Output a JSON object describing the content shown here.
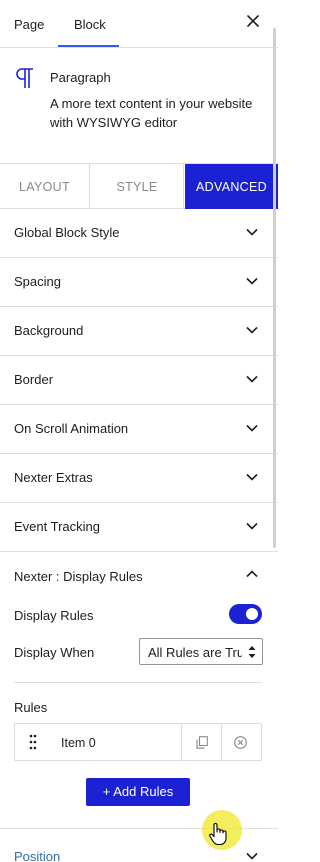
{
  "sidebar_tabs": {
    "page": "Page",
    "block": "Block"
  },
  "block_card": {
    "name": "Paragraph",
    "description": "A more text content in your website with WYSIWYG editor"
  },
  "settings_tabs": {
    "layout": "LAYOUT",
    "style": "STYLE",
    "advanced": "ADVANCED",
    "active": "ADVANCED"
  },
  "panels": [
    {
      "label": "Global Block Style"
    },
    {
      "label": "Spacing"
    },
    {
      "label": "Background"
    },
    {
      "label": "Border"
    },
    {
      "label": "On Scroll Animation"
    },
    {
      "label": "Nexter Extras"
    },
    {
      "label": "Event Tracking"
    }
  ],
  "display_rules": {
    "title": "Nexter : Display Rules",
    "toggle_label": "Display Rules",
    "toggle_on": true,
    "display_when_label": "Display When",
    "display_when_value": "All Rules are True",
    "rules_label": "Rules",
    "items": [
      {
        "label": "Item 0"
      }
    ],
    "add_button": "+ Add Rules"
  },
  "position_panel": {
    "label": "Position"
  },
  "colors": {
    "accent": "#1a22d3",
    "tab_underline": "#3858e9",
    "position_link": "#2f6fa8",
    "cursor_highlight": "#f0e828"
  },
  "icons": [
    "close-icon",
    "paragraph-icon",
    "chevron-down-icon",
    "chevron-up-icon",
    "drag-handle-icon",
    "duplicate-icon",
    "remove-icon",
    "hand-cursor-icon"
  ]
}
